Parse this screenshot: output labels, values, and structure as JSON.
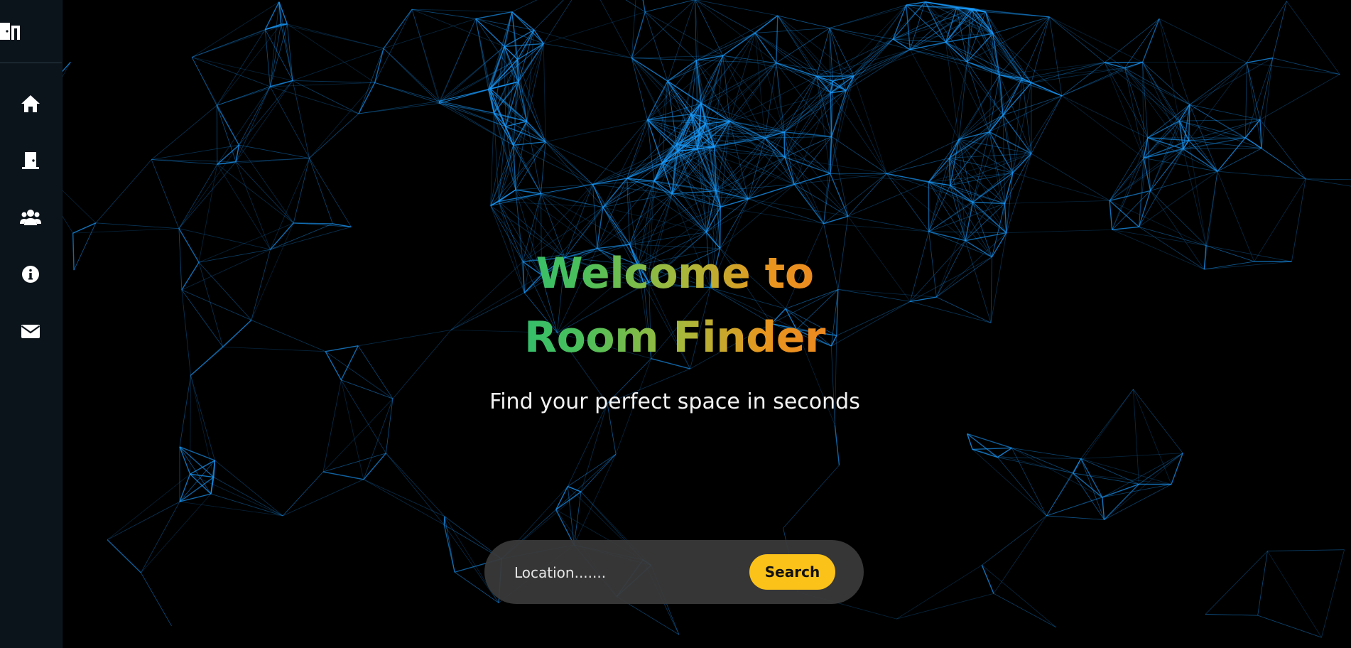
{
  "hero": {
    "title": "Welcome to Room Finder",
    "subtitle": "Find your perfect space in seconds"
  },
  "search": {
    "placeholder": "Location.......",
    "button_label": "Search"
  },
  "sidebar": {
    "items": [
      {
        "icon": "home-icon"
      },
      {
        "icon": "door-icon"
      },
      {
        "icon": "users-icon"
      },
      {
        "icon": "info-icon"
      },
      {
        "icon": "envelope-icon"
      }
    ]
  },
  "colors": {
    "background": "#000000",
    "sidebar": "#0c141b",
    "network_lines": "#1a9cff",
    "gradient_start": "#1fbe7a",
    "gradient_end": "#ef7d24",
    "search_button": "#fbc21a",
    "search_bar": "#3a3a3a"
  }
}
